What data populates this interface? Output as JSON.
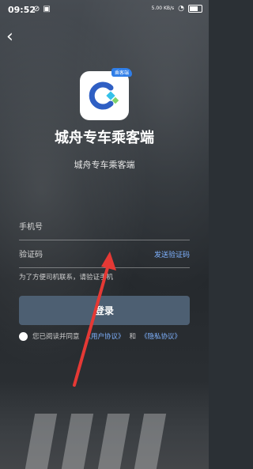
{
  "status_bar": {
    "time": "09:52",
    "network_speed": "5.00 KB/s"
  },
  "app": {
    "title": "城舟专车乘客端",
    "subtitle": "城舟专车乘客端",
    "badge": "乘客端"
  },
  "form": {
    "phone_placeholder": "手机号",
    "code_placeholder": "验证码",
    "send_code_label": "发送验证码",
    "hint": "为了方便司机联系，请验证手机",
    "login_label": "登录"
  },
  "agreement": {
    "prefix": "您已阅读并同意",
    "user_agreement": "《用户协议》",
    "and": "和",
    "privacy_policy": "《隐私协议》"
  },
  "colors": {
    "accent": "#2f7ee8",
    "link": "#7fb2ff",
    "arrow": "#e53935"
  }
}
